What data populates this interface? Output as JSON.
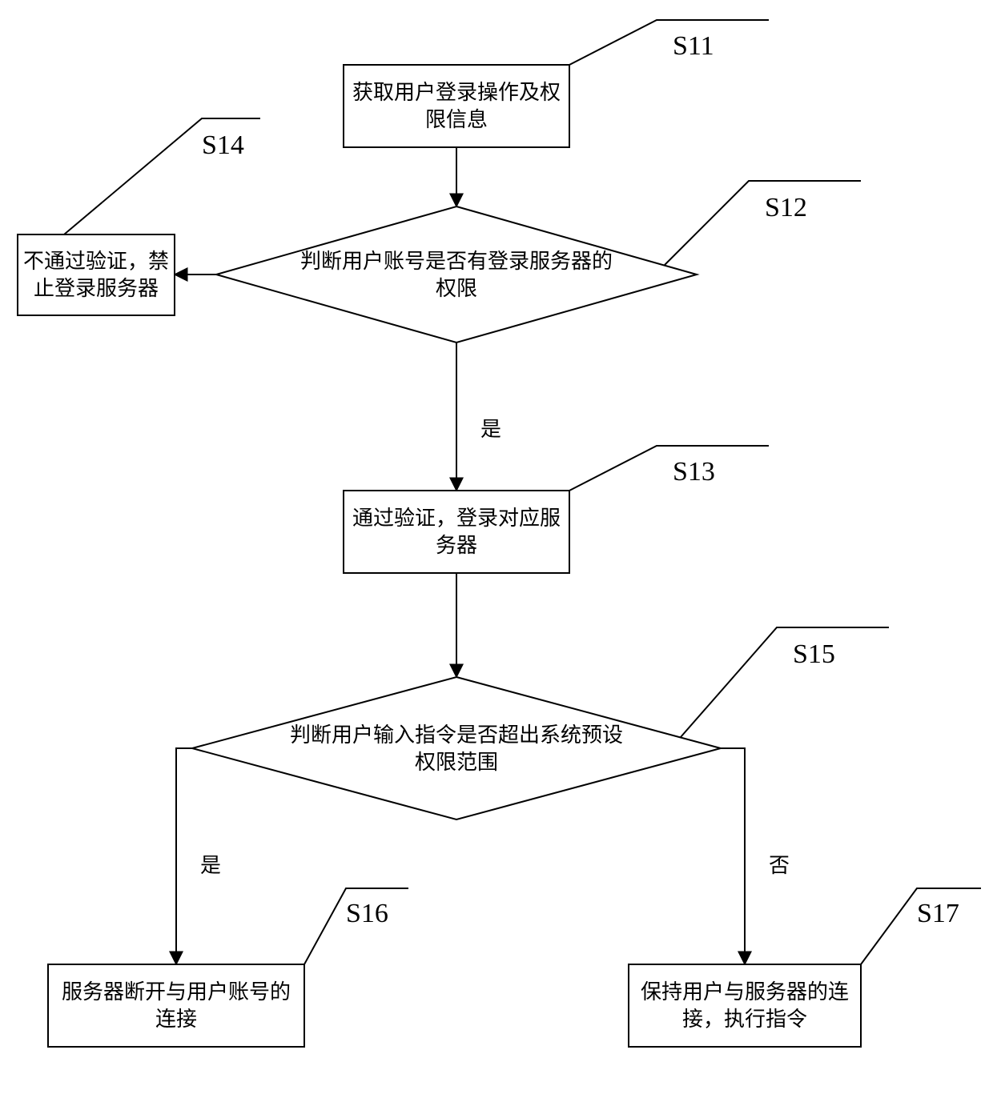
{
  "chart_data": {
    "type": "flowchart",
    "nodes": [
      {
        "id": "S11",
        "shape": "process",
        "text": "获取用户登录操作及权限信息"
      },
      {
        "id": "S12",
        "shape": "decision",
        "text": "判断用户账号是否有登录服务器的权限"
      },
      {
        "id": "S13",
        "shape": "process",
        "text": "通过验证，登录对应服务器"
      },
      {
        "id": "S14",
        "shape": "process",
        "text": "不通过验证，禁止登录服务器"
      },
      {
        "id": "S15",
        "shape": "decision",
        "text": "判断用户输入指令是否超出系统预设权限范围"
      },
      {
        "id": "S16",
        "shape": "process",
        "text": "服务器断开与用户账号的连接"
      },
      {
        "id": "S17",
        "shape": "process",
        "text": "保持用户与服务器的连接，执行指令"
      }
    ],
    "edges": [
      {
        "from": "S11",
        "to": "S12",
        "label": ""
      },
      {
        "from": "S12",
        "to": "S13",
        "label": "是"
      },
      {
        "from": "S12",
        "to": "S14",
        "label": ""
      },
      {
        "from": "S13",
        "to": "S15",
        "label": ""
      },
      {
        "from": "S15",
        "to": "S16",
        "label": "是"
      },
      {
        "from": "S15",
        "to": "S17",
        "label": "否"
      }
    ]
  },
  "boxes": {
    "s11": {
      "l1": "获取用户登录操作及权",
      "l2": "限信息"
    },
    "s12": {
      "l1": "判断用户账号是否有登录服务器的",
      "l2": "权限"
    },
    "s13": {
      "l1": "通过验证，登录对应服",
      "l2": "务器"
    },
    "s14": {
      "l1": "不通过验证，禁",
      "l2": "止登录服务器"
    },
    "s15": {
      "l1": "判断用户输入指令是否超出系统预设",
      "l2": "权限范围"
    },
    "s16": {
      "l1": "服务器断开与用户账号的",
      "l2": "连接"
    },
    "s17": {
      "l1": "保持用户与服务器的连",
      "l2": "接，执行指令"
    }
  },
  "labels": {
    "s11": "S11",
    "s12": "S12",
    "s13": "S13",
    "s14": "S14",
    "s15": "S15",
    "s16": "S16",
    "s17": "S17"
  },
  "edgeLabels": {
    "s12_s13": "是",
    "s15_s16": "是",
    "s15_s17": "否"
  }
}
